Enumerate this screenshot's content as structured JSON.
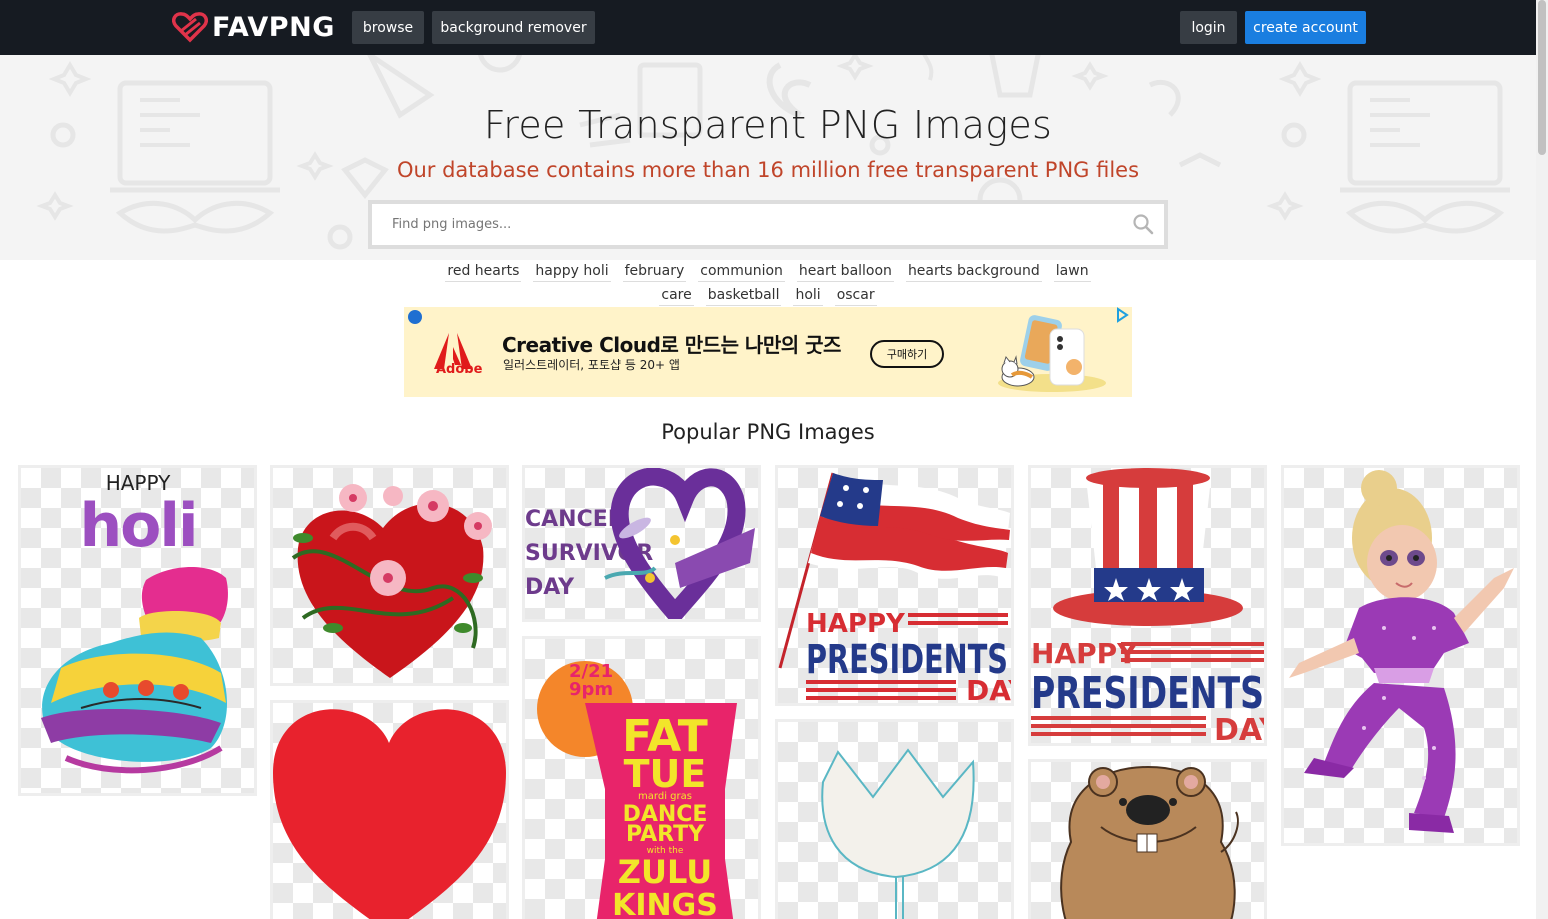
{
  "header": {
    "logo_text": "FAVPNG",
    "nav": {
      "browse": "browse",
      "background_remover": "background remover"
    },
    "auth": {
      "login": "login",
      "create_account": "create account"
    }
  },
  "hero": {
    "title": "Free Transparent PNG Images",
    "subtitle": "Our database contains more than 16 million free transparent PNG files",
    "search": {
      "placeholder": "Find png images...",
      "value": ""
    }
  },
  "tags": [
    "red hearts",
    "happy holi",
    "february",
    "communion",
    "heart balloon",
    "hearts background",
    "lawn",
    "care",
    "basketball",
    "holi",
    "oscar"
  ],
  "ad": {
    "brand": "Adobe",
    "headline": "Creative Cloud로 만드는 나만의 굿즈",
    "subline": "일러스트레이터, 포토샵 등 20+ 앱",
    "button": "구매하기"
  },
  "popular": {
    "title": "Popular PNG Images",
    "images": {
      "holi": {
        "line1": "HAPPY",
        "line2": "holi"
      },
      "cancer": {
        "line1": "CANCER",
        "line2": "SURVIVOR",
        "line3": "DAY"
      },
      "presidents1": {
        "line1": "HAPPY",
        "line2": "PRESIDENTS",
        "line3": "DAY"
      },
      "presidents2": {
        "line1": "HAPPY",
        "line2": "PRESIDENTS",
        "line3": "DAY"
      },
      "fat_tue": {
        "date": "2/21",
        "time": "9pm",
        "line1": "FAT",
        "line2": "TUE",
        "line3": "mardi gras",
        "line4": "DANCE",
        "line5": "PARTY",
        "line6": "with the",
        "line7": "ZULU",
        "line8": "KINGS"
      }
    }
  },
  "colors": {
    "topbar": "#161b22",
    "accent": "#1a7ee0",
    "subtitle": "#c0452a"
  }
}
